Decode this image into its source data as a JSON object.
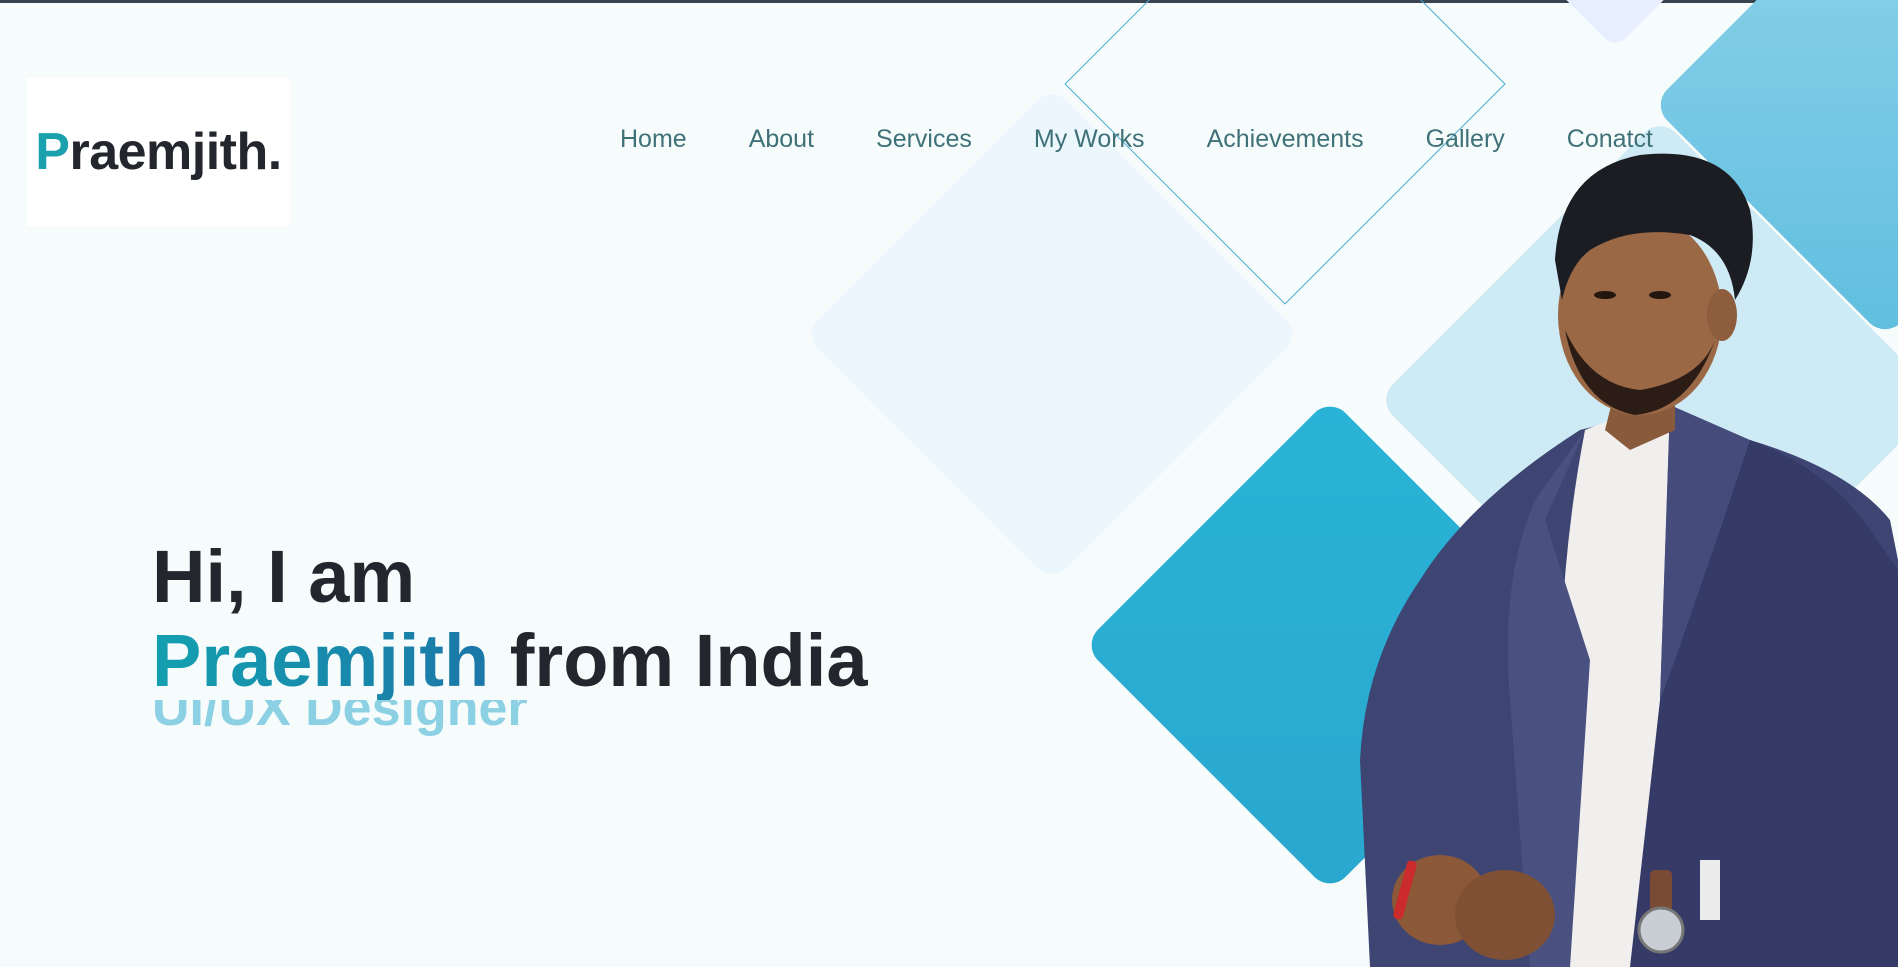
{
  "logo": {
    "initial": "P",
    "rest": "raemjith."
  },
  "nav": {
    "items": [
      {
        "label": "Home"
      },
      {
        "label": "About"
      },
      {
        "label": "Services"
      },
      {
        "label": "My Works"
      },
      {
        "label": "Achievements"
      },
      {
        "label": "Gallery"
      },
      {
        "label": "Conatct"
      }
    ]
  },
  "hero": {
    "greeting": "Hi, I am",
    "name": "Praemjith",
    "suffix": " from India",
    "role": "UI/UX Designer"
  },
  "colors": {
    "accent": "#1ba1ad",
    "nav_text": "#3f7178",
    "heading": "#23272d",
    "primary_diamond": "#29b3d7",
    "background": "#f6fcfc"
  }
}
